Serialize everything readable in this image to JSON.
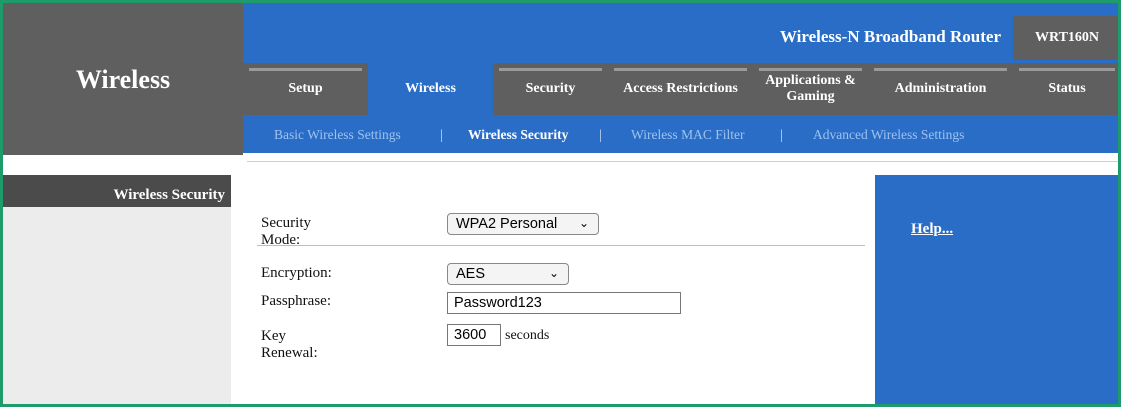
{
  "header": {
    "product_name": "Wireless-N Broadband Router",
    "model": "WRT160N",
    "section_title": "Wireless"
  },
  "nav": {
    "tabs": [
      {
        "label": "Setup",
        "active": false
      },
      {
        "label": "Wireless",
        "active": true
      },
      {
        "label": "Security",
        "active": false
      },
      {
        "label": "Access Restrictions",
        "active": false
      },
      {
        "label": "Applications & Gaming",
        "active": false
      },
      {
        "label": "Administration",
        "active": false
      },
      {
        "label": "Status",
        "active": false
      }
    ],
    "subtabs": [
      {
        "label": "Basic Wireless Settings",
        "active": false
      },
      {
        "label": "Wireless Security",
        "active": true
      },
      {
        "label": "Wireless MAC Filter",
        "active": false
      },
      {
        "label": "Advanced Wireless Settings",
        "active": false
      }
    ],
    "separator": "|"
  },
  "sidebar": {
    "heading": "Wireless Security"
  },
  "form": {
    "security_mode": {
      "label": "Security Mode:",
      "value": "WPA2 Personal"
    },
    "encryption": {
      "label": "Encryption:",
      "value": "AES"
    },
    "passphrase": {
      "label": "Passphrase:",
      "value": "Password123"
    },
    "key_renewal": {
      "label": "Key Renewal:",
      "value": "3600",
      "unit": "seconds"
    }
  },
  "help": {
    "link_label": "Help..."
  },
  "colors": {
    "accent_blue": "#2a6dc6",
    "nav_gray": "#5f5f5f",
    "frame_green": "#1f9a6a"
  }
}
